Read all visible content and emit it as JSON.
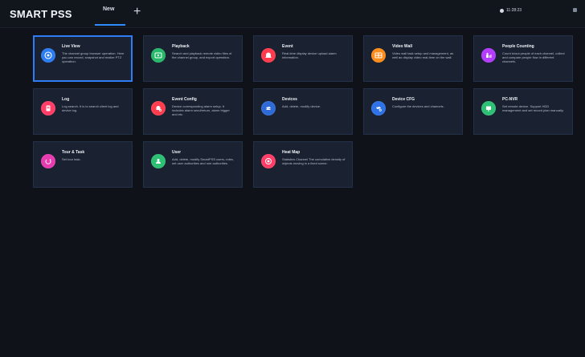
{
  "app": {
    "brand": "SMART PSS"
  },
  "tabs": [
    {
      "label": "New"
    }
  ],
  "header": {
    "time": "11:28:23"
  },
  "tiles": [
    {
      "title": "Live View",
      "description": "The channel group browser operation. Here you can record, snapshot and realize PTZ operation.",
      "icon": "live-view-icon",
      "color": "#2b7cf2",
      "selected": true
    },
    {
      "title": "Playback",
      "description": "Search and playback remote video files of the channel group, and export operation.",
      "icon": "playback-icon",
      "color": "#26b86a"
    },
    {
      "title": "Event",
      "description": "Real-time display device upload alarm information.",
      "icon": "event-icon",
      "color": "#ff3b4d"
    },
    {
      "title": "Video Wall",
      "description": "Video wall task setup and management, as well as display video real-time on the wall.",
      "icon": "video-wall-icon",
      "color": "#ff8b1a"
    },
    {
      "title": "People Counting",
      "description": "Count in/out people of each channel, collect and compare people flow in different channels.",
      "icon": "people-counting-icon",
      "color": "#b43cff"
    },
    {
      "title": "Log",
      "description": "Log search. It is to search client log and device log.",
      "icon": "log-icon",
      "color": "#ff3d66"
    },
    {
      "title": "Event Config",
      "description": "Device corresponding alarm setup. It includes alarm send/return, alarm trigger and etc.",
      "icon": "event-config-icon",
      "color": "#ff3d4f"
    },
    {
      "title": "Devices",
      "description": "Add, delete, modify device.",
      "icon": "devices-icon",
      "color": "#2f6bd6"
    },
    {
      "title": "Device CFG",
      "description": "Configure the devices and channels.",
      "icon": "device-cfg-icon",
      "color": "#2f72e7"
    },
    {
      "title": "PC-NVR",
      "description": "Set remote device. Support HDD management and set record plan manually.",
      "icon": "pc-nvr-icon",
      "color": "#2dbf73"
    },
    {
      "title": "Tour & Task",
      "description": "Set tour task.",
      "icon": "tour-task-icon",
      "color": "#e93bb0"
    },
    {
      "title": "User",
      "description": "Add, delete, modify SmartPSS users, roles, set user authorities and role authorities.",
      "icon": "user-icon",
      "color": "#2dbf73"
    },
    {
      "title": "Heat Map",
      "description": "Statistics Channel The cumulative density of objects moving in a fixed scene.",
      "icon": "heat-map-icon",
      "color": "#ff3d66"
    }
  ]
}
